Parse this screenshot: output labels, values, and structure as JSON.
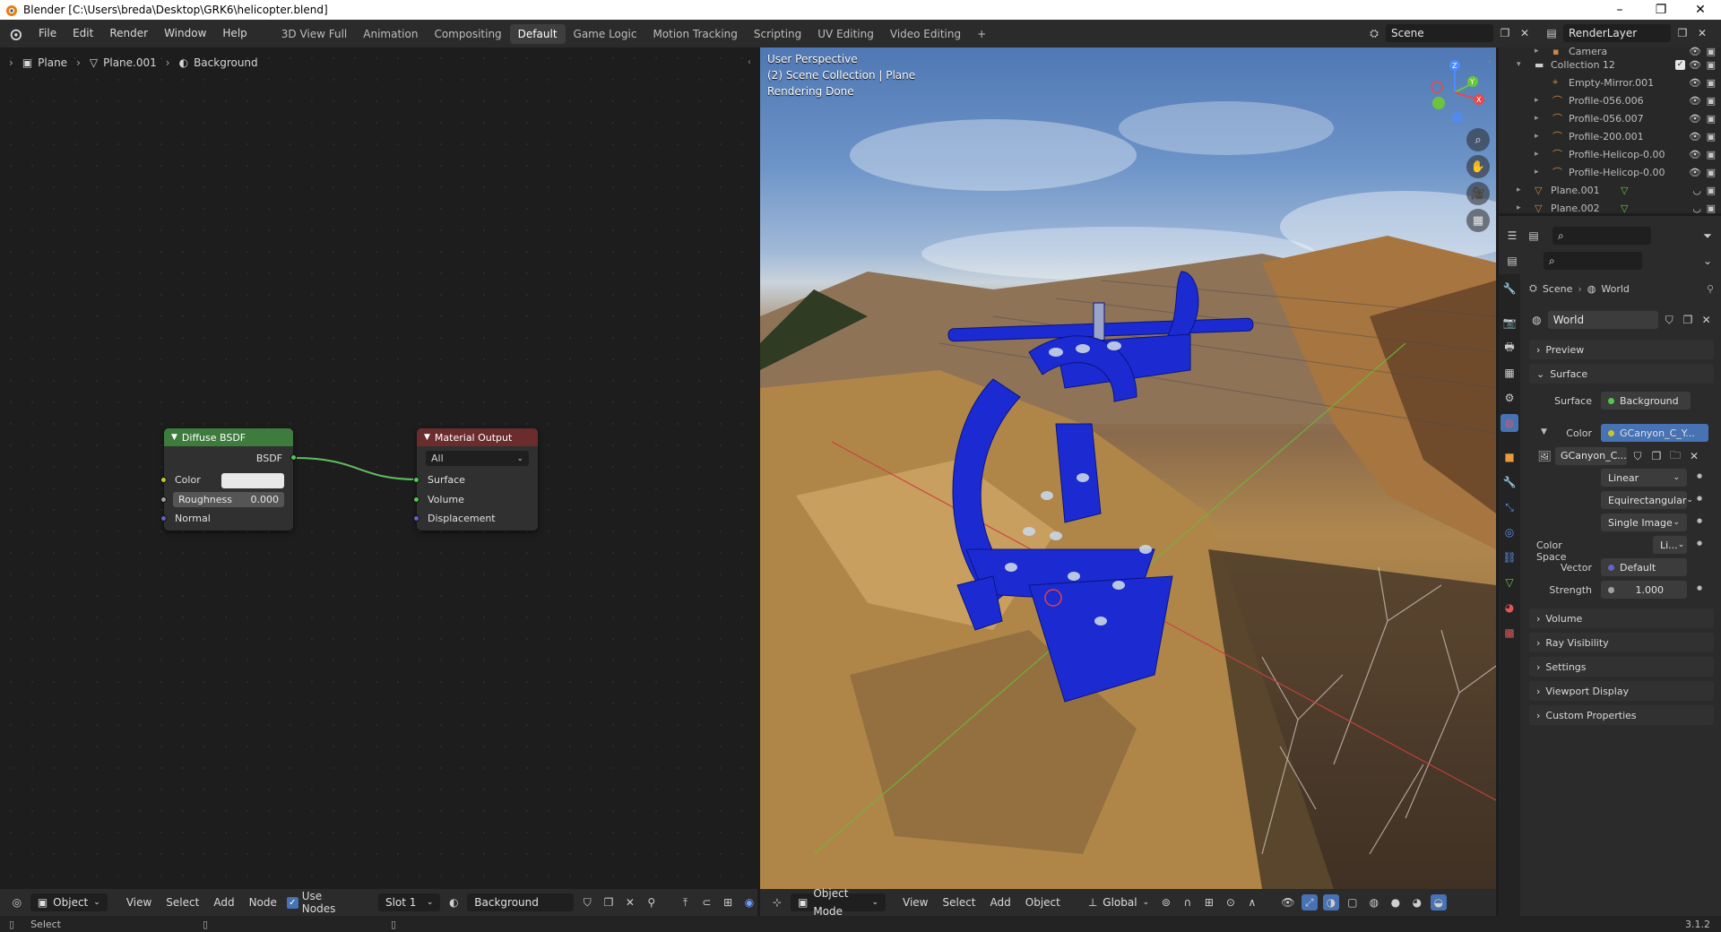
{
  "window": {
    "title": "Blender [C:\\Users\\breda\\Desktop\\GRK6\\helicopter.blend]",
    "minimize": "–",
    "maximize": "❐",
    "close": "✕"
  },
  "menu": [
    "File",
    "Edit",
    "Render",
    "Window",
    "Help"
  ],
  "workspaces": [
    "3D View Full",
    "Animation",
    "Compositing",
    "Default",
    "Game Logic",
    "Motion Tracking",
    "Scripting",
    "UV Editing",
    "Video Editing"
  ],
  "active_workspace": "Default",
  "add_workspace": "+",
  "scene_field": "Scene",
  "renderlayer_field": "RenderLayer",
  "node_editor": {
    "breadcrumb": [
      "Plane",
      "Plane.001",
      "Background"
    ],
    "diffuse_node": {
      "title": "Diffuse BSDF",
      "output": "BSDF",
      "inputs": {
        "color": "Color",
        "roughness": "Roughness",
        "roughness_value": "0.000",
        "normal": "Normal"
      }
    },
    "output_node": {
      "title": "Material Output",
      "target": "All",
      "inputs": {
        "surface": "Surface",
        "volume": "Volume",
        "displacement": "Displacement"
      }
    },
    "toolbar": {
      "mode": "Object",
      "view": "View",
      "select": "Select",
      "add": "Add",
      "node": "Node",
      "use_nodes": "Use Nodes",
      "slot": "Slot 1",
      "material": "Background"
    }
  },
  "viewport": {
    "perspective": "User Perspective",
    "collection": "(2) Scene Collection | Plane",
    "status": "Rendering Done",
    "gizmo": {
      "z": "Z",
      "y": "Y",
      "x": "X"
    },
    "toolbar": {
      "mode": "Object Mode",
      "view": "View",
      "select": "Select",
      "add": "Add",
      "object": "Object",
      "orientation": "Global"
    }
  },
  "outliner": {
    "rows": [
      {
        "name": "Camera",
        "indent": 2
      },
      {
        "name": "Collection 12",
        "indent": 1
      },
      {
        "name": "Empty-Mirror.001",
        "indent": 2
      },
      {
        "name": "Profile-056.006",
        "indent": 2
      },
      {
        "name": "Profile-056.007",
        "indent": 2
      },
      {
        "name": "Profile-200.001",
        "indent": 2
      },
      {
        "name": "Profile-Helicop-0.00",
        "indent": 2
      },
      {
        "name": "Profile-Helicop-0.00",
        "indent": 2
      },
      {
        "name": "Plane.001",
        "indent": 1
      },
      {
        "name": "Plane.002",
        "indent": 1
      }
    ]
  },
  "properties": {
    "breadcrumb": [
      "Scene",
      "World"
    ],
    "world_name": "World",
    "panels": {
      "preview": "Preview",
      "surface": "Surface",
      "volume": "Volume",
      "ray_visibility": "Ray Visibility",
      "settings": "Settings",
      "viewport_display": "Viewport Display",
      "custom_properties": "Custom Properties"
    },
    "surface": {
      "surface_label": "Surface",
      "surface_value": "Background",
      "color_label": "Color",
      "color_value": "GCanyon_C_Y...",
      "image_name": "GCanyon_C...",
      "interpolation": "Linear",
      "projection": "Equirectangular",
      "source": "Single Image",
      "colorspace_label": "Color Space",
      "colorspace_value": "Li...",
      "vector_label": "Vector",
      "vector_value": "Default",
      "strength_label": "Strength",
      "strength_value": "1.000"
    }
  },
  "status": {
    "select": "Select",
    "version": "3.1.2"
  },
  "colors": {
    "accent": "#4772b3",
    "node_green": "#3d7c3d",
    "output_red": "#6a2c2c",
    "helicopter": "#1b2bd1"
  }
}
